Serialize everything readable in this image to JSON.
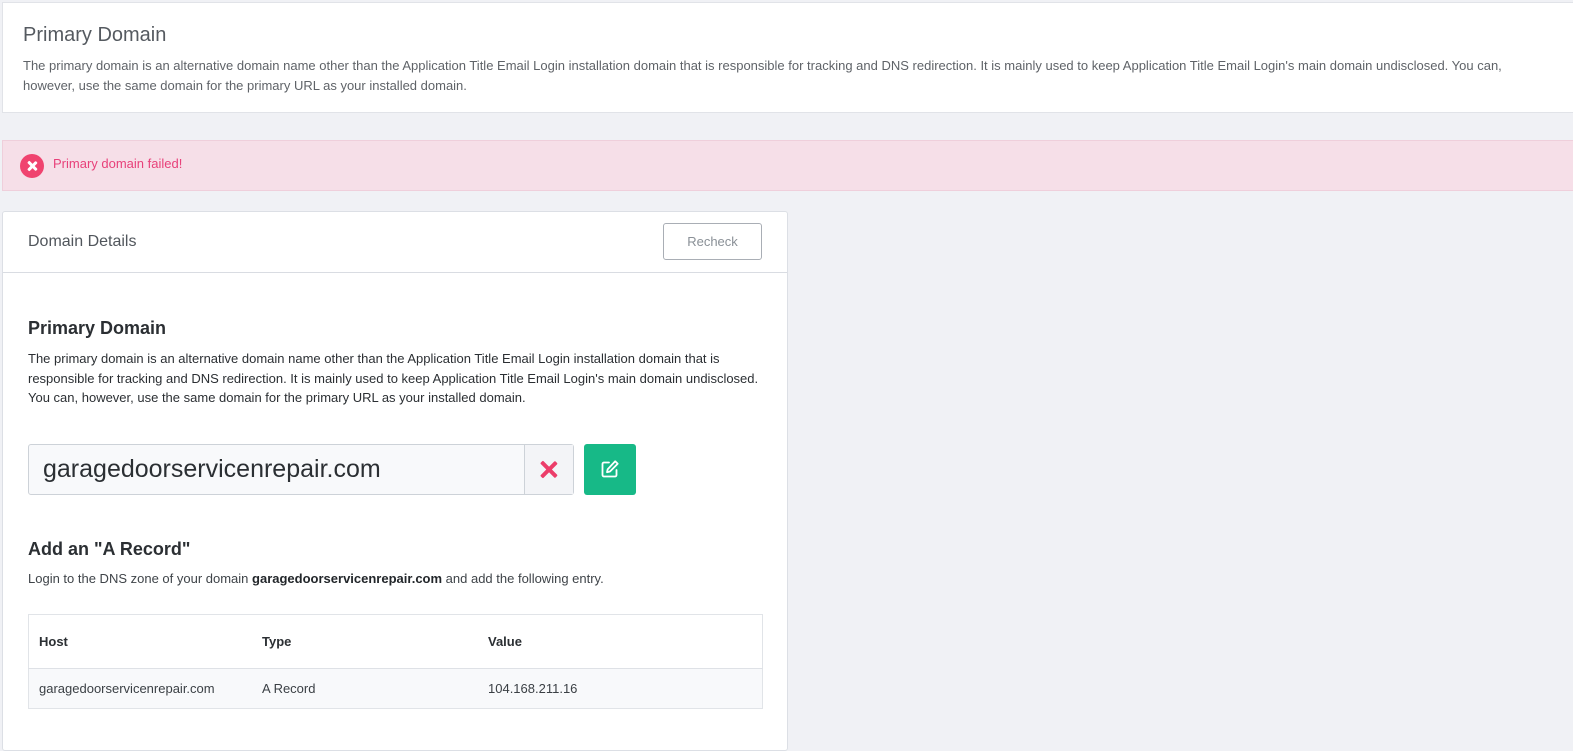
{
  "top_section": {
    "title": "Primary Domain",
    "description": "The primary domain is an alternative domain name other than the Application Title Email Login installation domain that is responsible for tracking and DNS redirection. It is mainly used to keep Application Title Email Login's main domain undisclosed. You can, however, use the same domain for the primary URL as your installed domain."
  },
  "alert": {
    "icon": "error-circle-icon",
    "message": "Primary domain failed!",
    "color": "#e8417a"
  },
  "domain_details": {
    "header_title": "Domain Details",
    "recheck_label": "Recheck",
    "primary_title": "Primary Domain",
    "primary_description": "The primary domain is an alternative domain name other than the Application Title Email Login installation domain that is responsible for tracking and DNS redirection. It is mainly used to keep Application Title Email Login's main domain undisclosed. You can, however, use the same domain for the primary URL as your installed domain.",
    "domain_value": "garagedoorservicenrepair.com",
    "clear_icon": "close-icon",
    "edit_icon": "edit-icon",
    "accent_color": "#17b987"
  },
  "a_record": {
    "title": "Add an \"A Record\"",
    "instruction_prefix": "Login to the DNS zone of your domain ",
    "instruction_domain": "garagedoorservicenrepair.com",
    "instruction_suffix": " and add the following entry.",
    "table": {
      "headers": {
        "host": "Host",
        "type": "Type",
        "value": "Value"
      },
      "rows": [
        {
          "host": "garagedoorservicenrepair.com",
          "type": "A Record",
          "value": "104.168.211.16"
        }
      ]
    }
  }
}
